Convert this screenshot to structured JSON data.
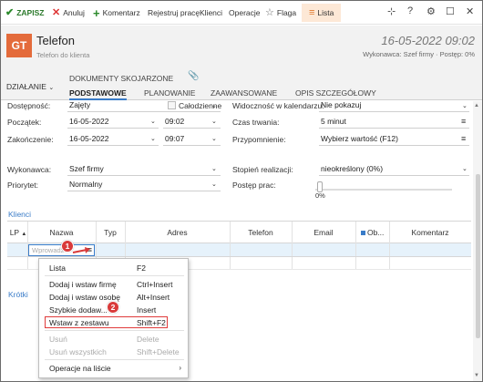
{
  "toolbar": {
    "save": "ZAPISZ",
    "cancel": "Anuluj",
    "comment": "Komentarz",
    "register_work": "Rejestruj pracę",
    "clients": "Klienci",
    "operations": "Operacje",
    "flag": "Flaga",
    "list": "Lista"
  },
  "header": {
    "badge": "GT",
    "title": "Telefon",
    "subtitle": "Telefon do klienta",
    "date": "16-05-2022 09:02",
    "meta": "Wykonawca: Szef firmy · Postęp: 0%"
  },
  "tabs": {
    "action": "DZIAŁANIE",
    "documents": "DOKUMENTY SKOJARZONE",
    "items": [
      "PODSTAWOWE",
      "PLANOWANIE",
      "ZAAWANSOWANE",
      "OPIS SZCZEGÓŁOWY"
    ]
  },
  "form": {
    "availability_label": "Dostępność:",
    "availability_value": "Zajęty",
    "allday_label": "Całodzienne",
    "calendar_visibility_label": "Widoczność w kalendarzu:",
    "calendar_visibility_value": "Nie pokazuj",
    "start_label": "Początek:",
    "start_date": "16-05-2022",
    "start_time": "09:02",
    "duration_label": "Czas trwania:",
    "duration_value": "5 minut",
    "end_label": "Zakończenie:",
    "end_date": "16-05-2022",
    "end_time": "09:07",
    "reminder_label": "Przypomnienie:",
    "reminder_value": "Wybierz wartość (F12)",
    "executor_label": "Wykonawca:",
    "executor_value": "Szef firmy",
    "realization_label": "Stopień realizacji:",
    "realization_value": "nieokreślony (0%)",
    "priority_label": "Priorytet:",
    "priority_value": "Normalny",
    "progress_label": "Postęp prac:",
    "progress_value": "0%"
  },
  "clients_section": "Klienci",
  "grid": {
    "columns": [
      "LP",
      "Nazwa",
      "Typ",
      "Adres",
      "Telefon",
      "Email",
      "Ob...",
      "Komentarz"
    ],
    "cell_placeholder": "Wprowadź"
  },
  "short_section": "Krótki",
  "menu": {
    "items": [
      {
        "label": "Lista",
        "shortcut": "F2",
        "disabled": false
      },
      {
        "label": "Dodaj i wstaw firmę",
        "shortcut": "Ctrl+Insert",
        "disabled": false
      },
      {
        "label": "Dodaj i wstaw osobę",
        "shortcut": "Alt+Insert",
        "disabled": false
      },
      {
        "label": "Szybkie dodaw...",
        "shortcut": "Insert",
        "disabled": false
      },
      {
        "label": "Wstaw z zestawu",
        "shortcut": "Shift+F2",
        "disabled": false
      },
      {
        "label": "Usuń",
        "shortcut": "Delete",
        "disabled": true
      },
      {
        "label": "Usuń wszystkich",
        "shortcut": "Shift+Delete",
        "disabled": true
      },
      {
        "label": "Operacje na liście",
        "shortcut": "",
        "disabled": false
      }
    ]
  },
  "markers": [
    "1",
    "2"
  ],
  "colors": {
    "accent": "#3a7cc8",
    "badge": "#e46b3b",
    "list_tab_bg": "#fde8d6",
    "marker": "#d93a3a",
    "highlight": "#e03b3b",
    "selected_row": "#e6f2fb"
  },
  "icons": {
    "save": "check-icon",
    "cancel": "x-icon",
    "comment": "plus-icon",
    "flag": "star-icon",
    "list": "list-icon",
    "attachment": "paperclip-icon"
  }
}
